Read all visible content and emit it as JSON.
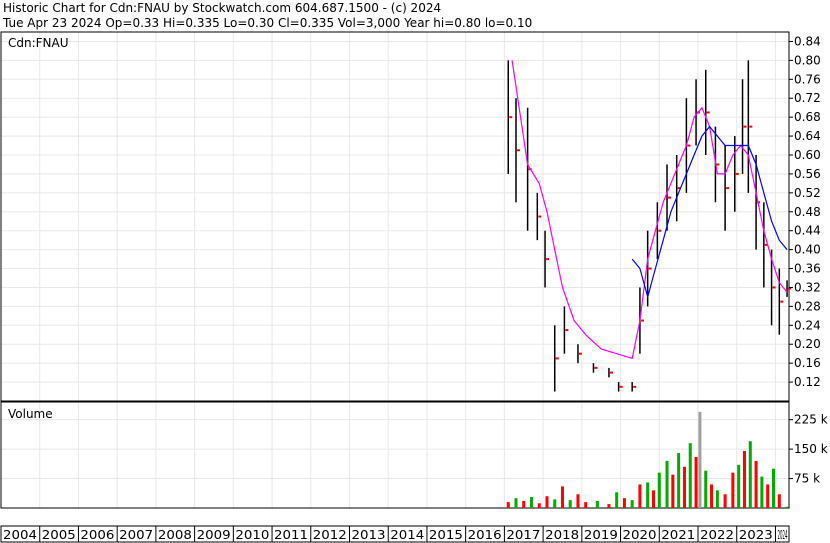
{
  "header": {
    "line1": "Historic Chart for Cdn:FNAU by Stockwatch.com 604.687.1500 - (c) 2024",
    "line2": "Tue Apr 23 2024  Op=0.33  Hi=0.335  Lo=0.30  Cl=0.335  Vol=3,000  Year hi=0.80  lo=0.10"
  },
  "chart_data": {
    "type": "line",
    "title": "Historic Chart for Cdn:FNAU",
    "price_panel_label": "Cdn:FNAU",
    "volume_panel_label": "Volume",
    "price_ylim": [
      0.08,
      0.86
    ],
    "price_ticks": [
      "0.84",
      "0.80",
      "0.76",
      "0.72",
      "0.68",
      "0.64",
      "0.60",
      "0.56",
      "0.52",
      "0.48",
      "0.44",
      "0.40",
      "0.36",
      "0.32",
      "0.28",
      "0.24",
      "0.20",
      "0.16",
      "0.12"
    ],
    "volume_ylim": [
      0,
      270000
    ],
    "volume_ticks": [
      {
        "value": 225000,
        "label": "225 k"
      },
      {
        "value": 150000,
        "label": "150 k"
      },
      {
        "value": 75000,
        "label": "75 k"
      }
    ],
    "x_range": [
      2004.0,
      2024.35
    ],
    "x_ticks": [
      "2004",
      "2005",
      "2006",
      "2007",
      "2008",
      "2009",
      "2010",
      "2011",
      "2012",
      "2013",
      "2014",
      "2015",
      "2016",
      "2017",
      "2018",
      "2019",
      "2020",
      "2021",
      "2022",
      "2023",
      "2024"
    ],
    "price_bars": [
      {
        "x": 2017.1,
        "hi": 0.8,
        "lo": 0.56
      },
      {
        "x": 2017.3,
        "hi": 0.72,
        "lo": 0.5
      },
      {
        "x": 2017.6,
        "hi": 0.7,
        "lo": 0.44
      },
      {
        "x": 2017.85,
        "hi": 0.52,
        "lo": 0.42
      },
      {
        "x": 2018.05,
        "hi": 0.44,
        "lo": 0.32
      },
      {
        "x": 2018.3,
        "hi": 0.24,
        "lo": 0.1
      },
      {
        "x": 2018.55,
        "hi": 0.28,
        "lo": 0.18
      },
      {
        "x": 2018.9,
        "hi": 0.2,
        "lo": 0.16
      },
      {
        "x": 2019.3,
        "hi": 0.16,
        "lo": 0.14
      },
      {
        "x": 2019.7,
        "hi": 0.15,
        "lo": 0.13
      },
      {
        "x": 2019.95,
        "hi": 0.12,
        "lo": 0.1
      },
      {
        "x": 2020.3,
        "hi": 0.12,
        "lo": 0.1
      },
      {
        "x": 2020.5,
        "hi": 0.32,
        "lo": 0.18
      },
      {
        "x": 2020.7,
        "hi": 0.44,
        "lo": 0.28
      },
      {
        "x": 2020.95,
        "hi": 0.5,
        "lo": 0.38
      },
      {
        "x": 2021.2,
        "hi": 0.58,
        "lo": 0.44
      },
      {
        "x": 2021.45,
        "hi": 0.6,
        "lo": 0.46
      },
      {
        "x": 2021.7,
        "hi": 0.72,
        "lo": 0.52
      },
      {
        "x": 2021.95,
        "hi": 0.76,
        "lo": 0.62
      },
      {
        "x": 2022.2,
        "hi": 0.78,
        "lo": 0.6
      },
      {
        "x": 2022.45,
        "hi": 0.66,
        "lo": 0.5
      },
      {
        "x": 2022.7,
        "hi": 0.62,
        "lo": 0.44
      },
      {
        "x": 2022.95,
        "hi": 0.64,
        "lo": 0.48
      },
      {
        "x": 2023.15,
        "hi": 0.76,
        "lo": 0.56
      },
      {
        "x": 2023.3,
        "hi": 0.8,
        "lo": 0.52
      },
      {
        "x": 2023.5,
        "hi": 0.6,
        "lo": 0.4
      },
      {
        "x": 2023.7,
        "hi": 0.5,
        "lo": 0.32
      },
      {
        "x": 2023.9,
        "hi": 0.4,
        "lo": 0.24
      },
      {
        "x": 2024.1,
        "hi": 0.36,
        "lo": 0.22
      },
      {
        "x": 2024.3,
        "hi": 0.335,
        "lo": 0.3
      }
    ],
    "series": [
      {
        "name": "",
        "color": "#ff00ff",
        "x": [
          2017.2,
          2017.6,
          2017.9,
          2018.1,
          2018.3,
          2018.5,
          2018.8,
          2019.1,
          2019.5,
          2019.9,
          2020.3,
          2020.5,
          2020.7,
          2020.9,
          2021.1,
          2021.3,
          2021.5,
          2021.7,
          2021.9,
          2022.1,
          2022.3,
          2022.5,
          2022.7,
          2022.9,
          2023.1,
          2023.3,
          2023.5,
          2023.7,
          2023.9,
          2024.1,
          2024.3
        ],
        "y": [
          0.8,
          0.58,
          0.54,
          0.48,
          0.4,
          0.32,
          0.25,
          0.22,
          0.19,
          0.18,
          0.17,
          0.25,
          0.38,
          0.44,
          0.5,
          0.54,
          0.58,
          0.62,
          0.68,
          0.7,
          0.66,
          0.56,
          0.56,
          0.6,
          0.62,
          0.6,
          0.52,
          0.44,
          0.38,
          0.33,
          0.31
        ]
      },
      {
        "name": "",
        "color": "#0000ff",
        "x": [
          2020.3,
          2020.5,
          2020.7,
          2020.9,
          2021.1,
          2021.3,
          2021.5,
          2021.7,
          2021.9,
          2022.1,
          2022.3,
          2022.5,
          2022.7,
          2022.9,
          2023.1,
          2023.3,
          2023.5,
          2023.7,
          2023.9,
          2024.1,
          2024.3
        ],
        "y": [
          0.38,
          0.36,
          0.3,
          0.36,
          0.42,
          0.48,
          0.52,
          0.56,
          0.6,
          0.64,
          0.66,
          0.64,
          0.62,
          0.62,
          0.62,
          0.62,
          0.58,
          0.52,
          0.46,
          0.42,
          0.4
        ]
      }
    ],
    "volume_bars": [
      {
        "x": 2017.1,
        "v": 15000,
        "color": "#ff0000"
      },
      {
        "x": 2017.3,
        "v": 25000,
        "color": "#00aa00"
      },
      {
        "x": 2017.5,
        "v": 18000,
        "color": "#ff0000"
      },
      {
        "x": 2017.7,
        "v": 28000,
        "color": "#00aa00"
      },
      {
        "x": 2017.9,
        "v": 12000,
        "color": "#ff0000"
      },
      {
        "x": 2018.1,
        "v": 30000,
        "color": "#ff0000"
      },
      {
        "x": 2018.3,
        "v": 22000,
        "color": "#00aa00"
      },
      {
        "x": 2018.5,
        "v": 55000,
        "color": "#ff0000"
      },
      {
        "x": 2018.7,
        "v": 20000,
        "color": "#00aa00"
      },
      {
        "x": 2018.9,
        "v": 35000,
        "color": "#ff0000"
      },
      {
        "x": 2019.1,
        "v": 15000,
        "color": "#ff0000"
      },
      {
        "x": 2019.4,
        "v": 18000,
        "color": "#00aa00"
      },
      {
        "x": 2019.7,
        "v": 10000,
        "color": "#ff0000"
      },
      {
        "x": 2019.9,
        "v": 40000,
        "color": "#00aa00"
      },
      {
        "x": 2020.1,
        "v": 25000,
        "color": "#ff0000"
      },
      {
        "x": 2020.3,
        "v": 20000,
        "color": "#00aa00"
      },
      {
        "x": 2020.5,
        "v": 60000,
        "color": "#ff0000"
      },
      {
        "x": 2020.7,
        "v": 65000,
        "color": "#00aa00"
      },
      {
        "x": 2020.85,
        "v": 45000,
        "color": "#ff0000"
      },
      {
        "x": 2021.0,
        "v": 90000,
        "color": "#00aa00"
      },
      {
        "x": 2021.2,
        "v": 120000,
        "color": "#00aa00"
      },
      {
        "x": 2021.35,
        "v": 85000,
        "color": "#ff0000"
      },
      {
        "x": 2021.5,
        "v": 140000,
        "color": "#00aa00"
      },
      {
        "x": 2021.65,
        "v": 105000,
        "color": "#ff0000"
      },
      {
        "x": 2021.8,
        "v": 165000,
        "color": "#00aa00"
      },
      {
        "x": 2021.95,
        "v": 130000,
        "color": "#ff0000"
      },
      {
        "x": 2022.05,
        "v": 245000,
        "color": "#a0a0a0"
      },
      {
        "x": 2022.2,
        "v": 95000,
        "color": "#00aa00"
      },
      {
        "x": 2022.35,
        "v": 60000,
        "color": "#ff0000"
      },
      {
        "x": 2022.5,
        "v": 45000,
        "color": "#00aa00"
      },
      {
        "x": 2022.7,
        "v": 35000,
        "color": "#ff0000"
      },
      {
        "x": 2022.9,
        "v": 90000,
        "color": "#ff0000"
      },
      {
        "x": 2023.05,
        "v": 110000,
        "color": "#00aa00"
      },
      {
        "x": 2023.2,
        "v": 145000,
        "color": "#ff0000"
      },
      {
        "x": 2023.35,
        "v": 170000,
        "color": "#00aa00"
      },
      {
        "x": 2023.5,
        "v": 120000,
        "color": "#ff0000"
      },
      {
        "x": 2023.65,
        "v": 80000,
        "color": "#00aa00"
      },
      {
        "x": 2023.8,
        "v": 60000,
        "color": "#ff0000"
      },
      {
        "x": 2023.95,
        "v": 100000,
        "color": "#00aa00"
      },
      {
        "x": 2024.1,
        "v": 35000,
        "color": "#ff0000"
      },
      {
        "x": 2024.3,
        "v": 3000,
        "color": "#00aa00"
      }
    ],
    "colors": {
      "bars": "#000000",
      "ticks_red": "#ff0000",
      "grid": "#e8e8e8",
      "frame": "#000000"
    }
  }
}
